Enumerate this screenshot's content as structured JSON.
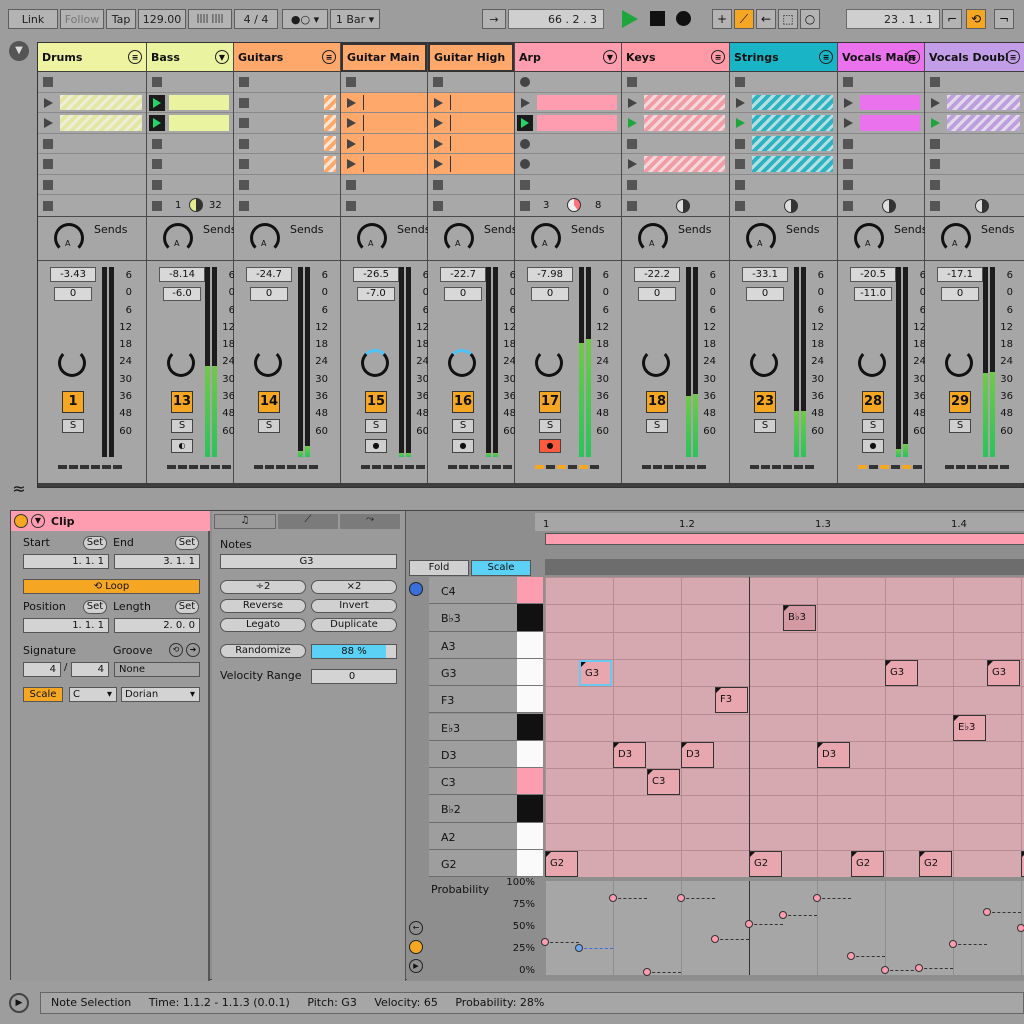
{
  "transport": {
    "link": "Link",
    "follow": "Follow",
    "tap": "Tap",
    "tempo": "129.00",
    "metro_icon": "metronome-icon",
    "signature": "4  /  4",
    "quantize": "1 Bar",
    "position": "66 .   2 .   3",
    "loop_start": "23 .   1 .   1"
  },
  "colors": {
    "drums": "#eef3a2",
    "bass": "#eaf4a0",
    "guitars": "#ffa86b",
    "arp": "#ff9db0",
    "keys": "#ff9aa6",
    "strings": "#19b5c6",
    "vocals_main": "#ea72ec",
    "vocals_doubl": "#c39ee8",
    "accent": "#f5a623"
  },
  "tracks": [
    {
      "name": "Drums",
      "vol": "-3.43",
      "pan": "0",
      "num": "1"
    },
    {
      "name": "Bass",
      "vol": "-8.14",
      "pan": "-6.0",
      "num": "13",
      "extra_left": "1",
      "extra_right": "32"
    },
    {
      "name": "Guitars",
      "vol": "-24.7",
      "pan": "0",
      "num": "14"
    },
    {
      "name": "Guitar Main",
      "vol": "-26.5",
      "pan": "-7.0",
      "num": "15"
    },
    {
      "name": "Guitar High",
      "vol": "-22.7",
      "pan": "0",
      "num": "16"
    },
    {
      "name": "Arp",
      "vol": "-7.98",
      "pan": "0",
      "num": "17",
      "extra_left": "3",
      "extra_right": "8"
    },
    {
      "name": "Keys",
      "vol": "-22.2",
      "pan": "0",
      "num": "18"
    },
    {
      "name": "Strings",
      "vol": "-33.1",
      "pan": "0",
      "num": "23"
    },
    {
      "name": "Vocals Main",
      "vol": "-20.5",
      "pan": "-11.0",
      "num": "28"
    },
    {
      "name": "Vocals Doubl",
      "vol": "-17.1",
      "pan": "0",
      "num": "29"
    }
  ],
  "sends_label": "Sends",
  "solo_label": "S",
  "meter_scale": [
    "6",
    "0",
    "6",
    "12",
    "18",
    "24",
    "30",
    "36",
    "48",
    "60"
  ],
  "clip": {
    "title": "Clip",
    "start_label": "Start",
    "end_label": "End",
    "set": "Set",
    "start": "1.    1.    1",
    "end": "3.    1.    1",
    "loop": "Loop",
    "position_label": "Position",
    "length_label": "Length",
    "position": "1.    1.    1",
    "length": "2.    0.    0",
    "signature_label": "Signature",
    "groove_label": "Groove",
    "sig_num": "4",
    "sig_den": "4",
    "groove": "None",
    "scale_btn": "Scale",
    "scale_root": "C",
    "scale_mode": "Dorian"
  },
  "notes_panel": {
    "title": "Notes",
    "pitch": "G3",
    "div2": "÷2",
    "mul2": "×2",
    "reverse": "Reverse",
    "invert": "Invert",
    "legato": "Legato",
    "duplicate": "Duplicate",
    "randomize": "Randomize",
    "rand_pct": "88 %",
    "velocity_range_label": "Velocity Range",
    "velocity_range": "0"
  },
  "editor": {
    "fold": "Fold",
    "scale": "Scale",
    "ruler": [
      "1",
      "1.2",
      "1.3",
      "1.4"
    ],
    "pitches": [
      "C4",
      "B♭3",
      "A3",
      "G3",
      "F3",
      "E♭3",
      "D3",
      "C3",
      "B♭2",
      "A2",
      "G2"
    ],
    "notes": [
      {
        "label": "G3",
        "row": 3,
        "beat": 0.5,
        "len": 0.5
      },
      {
        "label": "B♭3",
        "row": 1,
        "beat": 3.5,
        "len": 0.5
      },
      {
        "label": "G3",
        "row": 3,
        "beat": 5.0,
        "len": 0.5
      },
      {
        "label": "G3",
        "row": 3,
        "beat": 6.5,
        "len": 0.5
      },
      {
        "label": "F3",
        "row": 4,
        "beat": 2.5,
        "len": 0.5
      },
      {
        "label": "E♭3",
        "row": 5,
        "beat": 6.0,
        "len": 0.5
      },
      {
        "label": "D3",
        "row": 6,
        "beat": 1.0,
        "len": 0.5
      },
      {
        "label": "D3",
        "row": 6,
        "beat": 2.0,
        "len": 0.5
      },
      {
        "label": "D3",
        "row": 6,
        "beat": 4.0,
        "len": 0.5
      },
      {
        "label": "C3",
        "row": 7,
        "beat": 1.5,
        "len": 0.5
      },
      {
        "label": "G2",
        "row": 10,
        "beat": 0.0,
        "len": 0.5
      },
      {
        "label": "G2",
        "row": 10,
        "beat": 3.0,
        "len": 0.5
      },
      {
        "label": "G2",
        "row": 10,
        "beat": 4.5,
        "len": 0.5
      },
      {
        "label": "G2",
        "row": 10,
        "beat": 5.5,
        "len": 0.5
      },
      {
        "label": "G",
        "row": 10,
        "beat": 7.0,
        "len": 0.2
      }
    ],
    "probability_label": "Probability",
    "prob_ticks": [
      "100%",
      "75%",
      "50%",
      "25%",
      "0%"
    ],
    "probabilities": [
      {
        "beat": 0.0,
        "p": 35
      },
      {
        "beat": 0.5,
        "p": 28,
        "selected": true
      },
      {
        "beat": 1.0,
        "p": 85
      },
      {
        "beat": 1.5,
        "p": 0
      },
      {
        "beat": 2.0,
        "p": 85
      },
      {
        "beat": 2.5,
        "p": 38
      },
      {
        "beat": 3.0,
        "p": 55
      },
      {
        "beat": 3.5,
        "p": 65
      },
      {
        "beat": 4.0,
        "p": 85
      },
      {
        "beat": 4.5,
        "p": 18
      },
      {
        "beat": 5.0,
        "p": 3
      },
      {
        "beat": 5.5,
        "p": 5
      },
      {
        "beat": 6.0,
        "p": 32
      },
      {
        "beat": 6.5,
        "p": 68
      },
      {
        "beat": 7.0,
        "p": 50
      }
    ]
  },
  "status": {
    "text": "Note Selection     Time: 1.1.2 - 1.1.3 (0.0.1)     Pitch: G3     Velocity: 65     Probability: 28%"
  }
}
